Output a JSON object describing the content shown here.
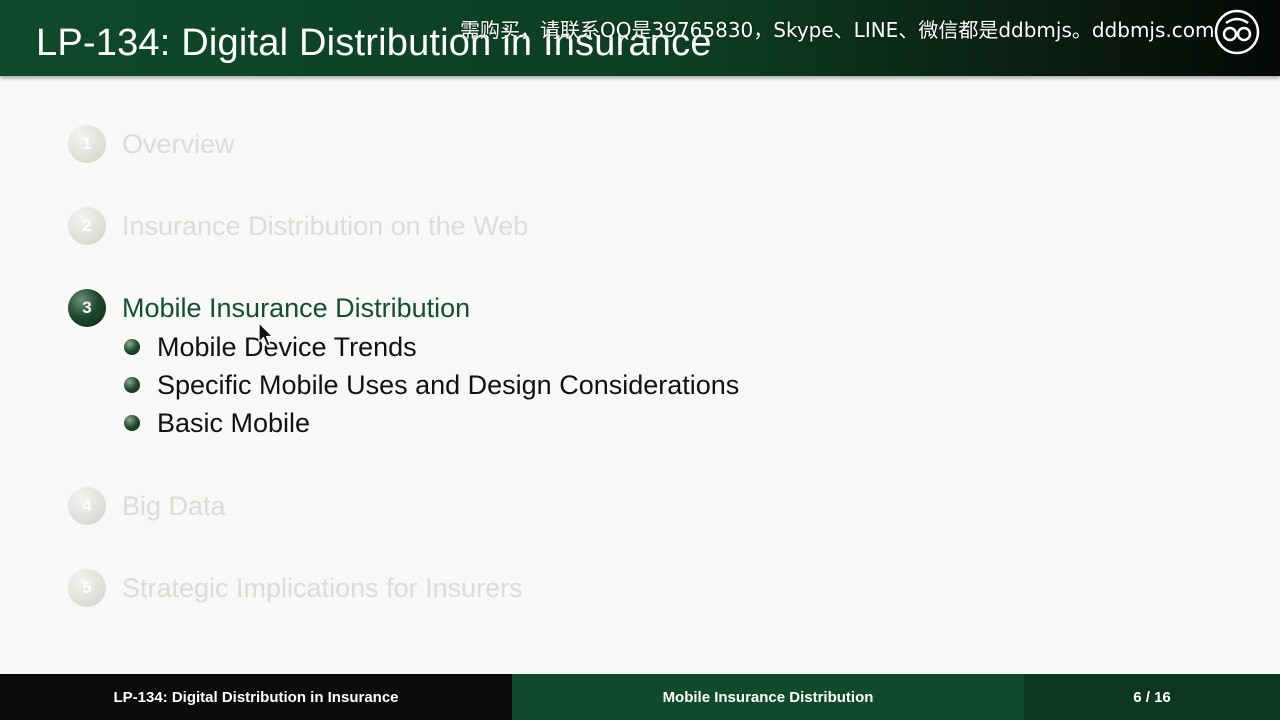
{
  "header": {
    "title": "LP-134: Digital Distribution in Insurance",
    "watermark": "需购买，请联系QQ是39765830，Skype、LINE、微信都是ddbmjs。ddbmjs.com"
  },
  "toc": {
    "items": [
      {
        "number": "1",
        "label": "Overview"
      },
      {
        "number": "2",
        "label": "Insurance Distribution on the Web"
      },
      {
        "number": "3",
        "label": "Mobile Insurance Distribution"
      },
      {
        "number": "4",
        "label": "Big Data"
      },
      {
        "number": "5",
        "label": "Strategic Implications for Insurers"
      }
    ],
    "active_subitems": [
      "Mobile Device Trends",
      "Specific Mobile Uses and Design Considerations",
      "Basic Mobile"
    ]
  },
  "footer": {
    "left": "LP-134: Digital Distribution in Insurance",
    "middle": "Mobile Insurance Distribution",
    "page": "6 / 16"
  },
  "colors": {
    "header_green": "#0f4a2a",
    "active_text": "#145030",
    "dim_text": "#dcdcd8"
  }
}
